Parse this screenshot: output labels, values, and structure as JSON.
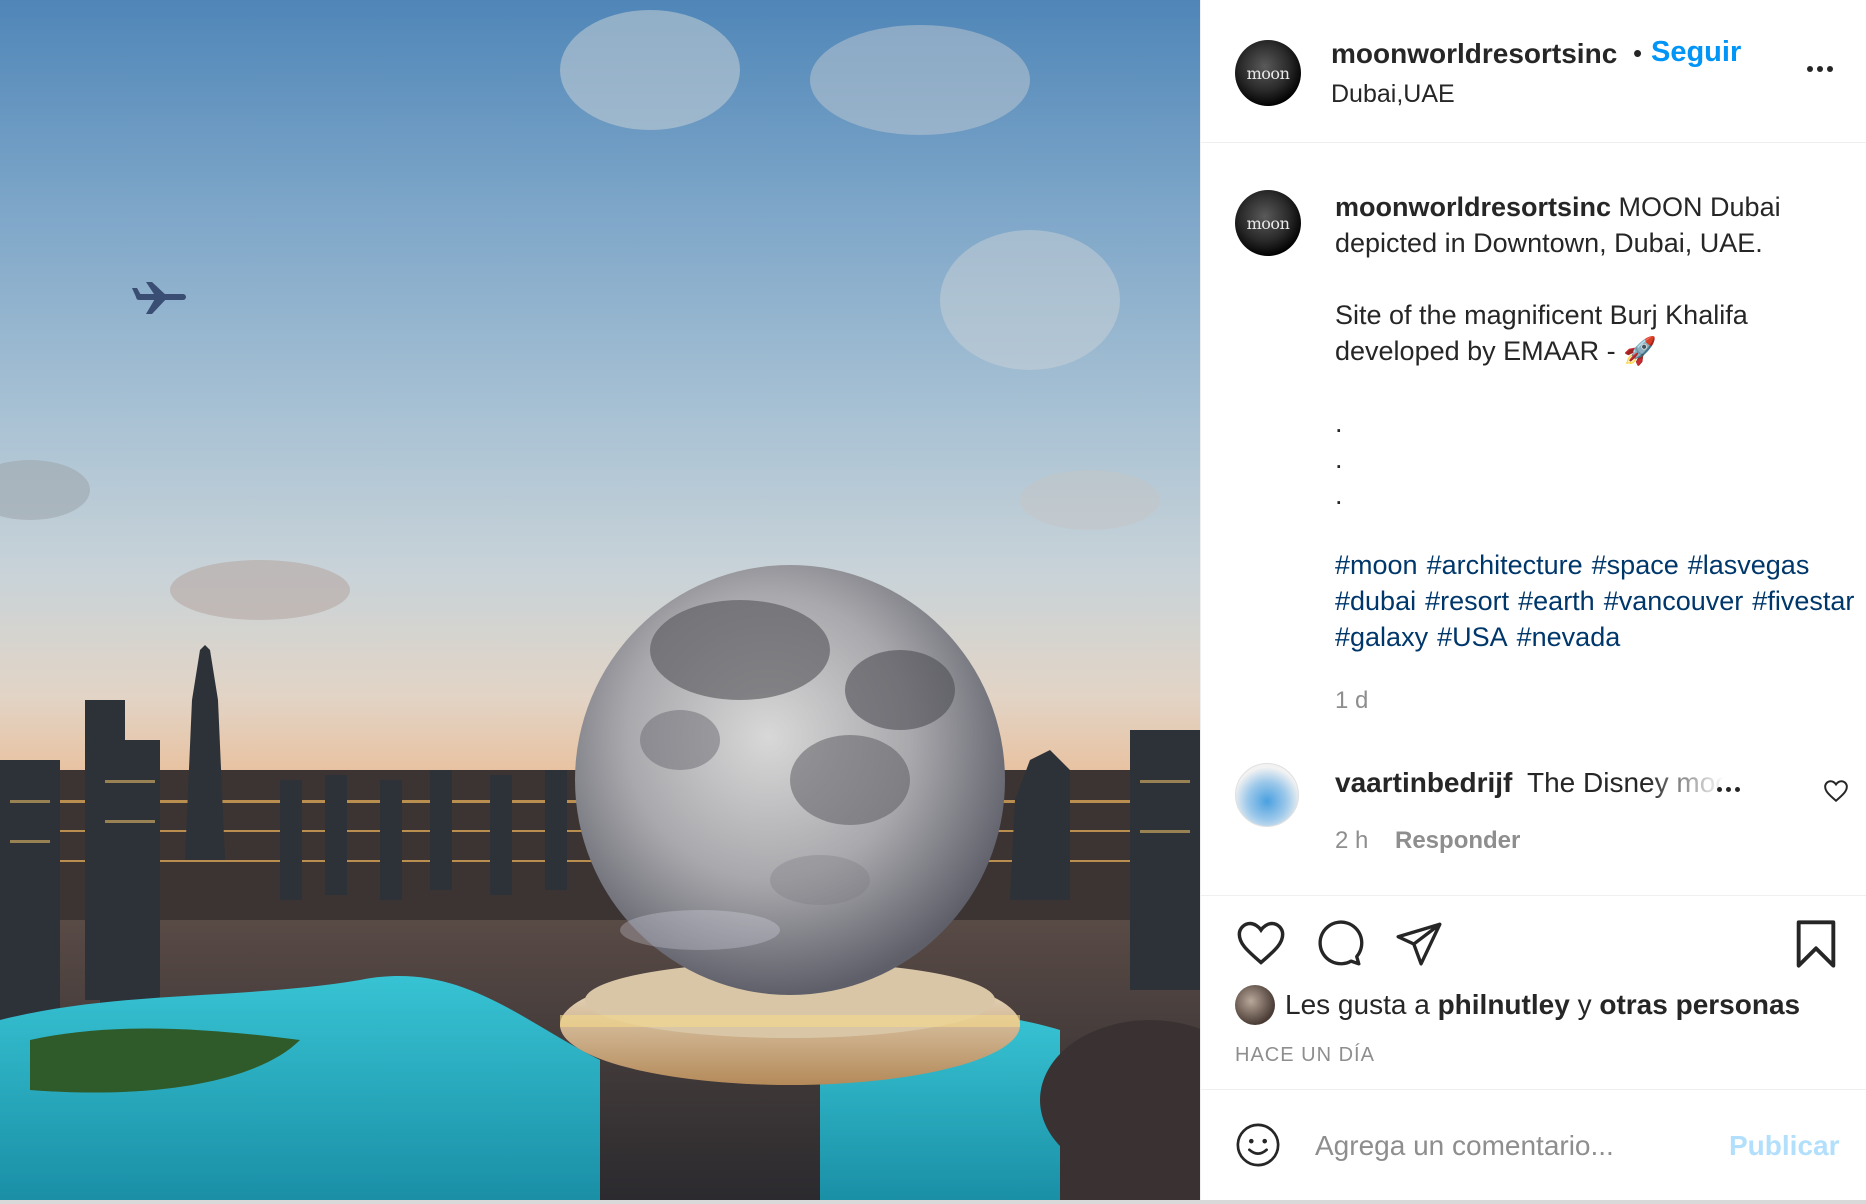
{
  "post": {
    "username": "moonworldresortsinc",
    "follow_label": "Seguir",
    "location": "Dubai,UAE",
    "avatar_text": "moon",
    "photo_alt": "MOON Dubai depicted in Downtown, Dubai, UAE."
  },
  "caption": {
    "username": "moonworldresortsinc",
    "text": " MOON Dubai depicted in Downtown, Dubai, UAE.\n\nSite of the magnificent Burj Khalifa developed by EMAAR - 🚀\n\n.\n.\n.",
    "hashtags": [
      "#moon",
      "#architecture",
      "#space",
      "#lasvegas",
      "#dubai",
      "#resort",
      "#earth",
      "#vancouver",
      "#fivestar",
      "#galaxy",
      "#USA",
      "#nevada"
    ],
    "age": "1 d"
  },
  "comment": {
    "username": "vaartinbedrijf",
    "text": "The Disney moon",
    "time": "2 h",
    "reply_label": "Responder"
  },
  "likes": {
    "prefix": "Les gusta a",
    "user": "philnutley",
    "joiner": "y",
    "others": "otras personas"
  },
  "timestamp": "HACE UN DÍA",
  "add_comment": {
    "placeholder": "Agrega un comentario...",
    "post_label": "Publicar"
  },
  "icons": {
    "more": "more-horizontal-icon",
    "like": "heart-icon",
    "comment": "comment-bubble-icon",
    "share": "paper-plane-icon",
    "save": "bookmark-icon",
    "emoji": "smiley-icon",
    "comment_like": "small-heart-icon"
  },
  "colors": {
    "accent": "#0095f6",
    "hashtag": "#00376b",
    "muted": "#8e8e8e",
    "publish_disabled": "#b2dffc"
  }
}
